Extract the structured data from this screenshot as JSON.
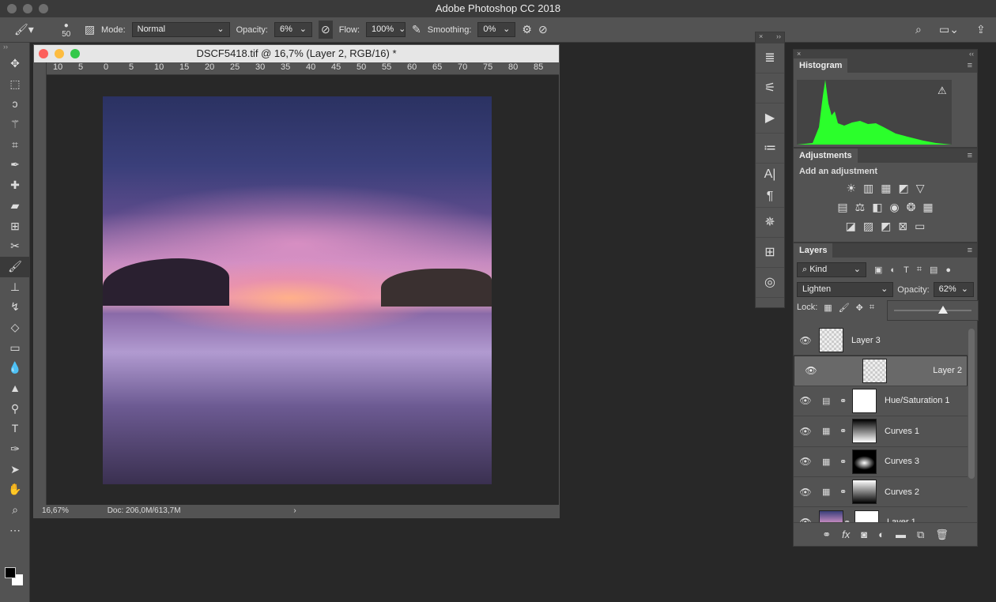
{
  "app": {
    "title": "Adobe Photoshop CC 2018"
  },
  "options": {
    "brush_size": "50",
    "mode_label": "Mode:",
    "mode": "Normal",
    "opacity_label": "Opacity:",
    "opacity": "6%",
    "flow_label": "Flow:",
    "flow": "100%",
    "smoothing_label": "Smoothing:",
    "smoothing": "0%"
  },
  "toolbar": {
    "tools": [
      "move",
      "marquee",
      "lasso",
      "magic-wand",
      "crop",
      "eyedropper",
      "healing",
      "patch",
      "content-aware",
      "transform",
      "brush",
      "stamp",
      "history-brush",
      "eraser",
      "gradient",
      "blur",
      "dodge",
      "pen-burn",
      "text",
      "pen",
      "path-select",
      "hand",
      "zoom",
      "more"
    ],
    "active": "brush",
    "foreground": "#000000",
    "background": "#ffffff"
  },
  "document": {
    "title": "DSCF5418.tif @ 16,7% (Layer 2, RGB/16) *",
    "ruler_ticks": [
      "10",
      "5",
      "0",
      "5",
      "10",
      "15",
      "20",
      "25",
      "30",
      "35",
      "40",
      "45",
      "50",
      "55",
      "60",
      "65",
      "70",
      "75",
      "80",
      "85"
    ],
    "zoom": "16,67%",
    "doc_size": "Doc: 206,0M/613,7M"
  },
  "histogram": {
    "title": "Histogram",
    "color": "#2bff2b"
  },
  "adjustments": {
    "title": "Adjustments",
    "subtitle": "Add an adjustment"
  },
  "layers": {
    "title": "Layers",
    "filter": "Kind",
    "blend_mode": "Lighten",
    "opacity_label": "Opacity:",
    "opacity": "62%",
    "opacity_slider": 0.62,
    "lock_label": "Lock:",
    "items": [
      {
        "name": "Layer 3",
        "selected": false
      },
      {
        "name": "Layer 2",
        "selected": true
      },
      {
        "name": "Hue/Saturation 1",
        "selected": false
      },
      {
        "name": "Curves 1",
        "selected": false
      },
      {
        "name": "Curves 3",
        "selected": false
      },
      {
        "name": "Curves 2",
        "selected": false
      },
      {
        "name": "Layer 1",
        "selected": false
      }
    ]
  }
}
